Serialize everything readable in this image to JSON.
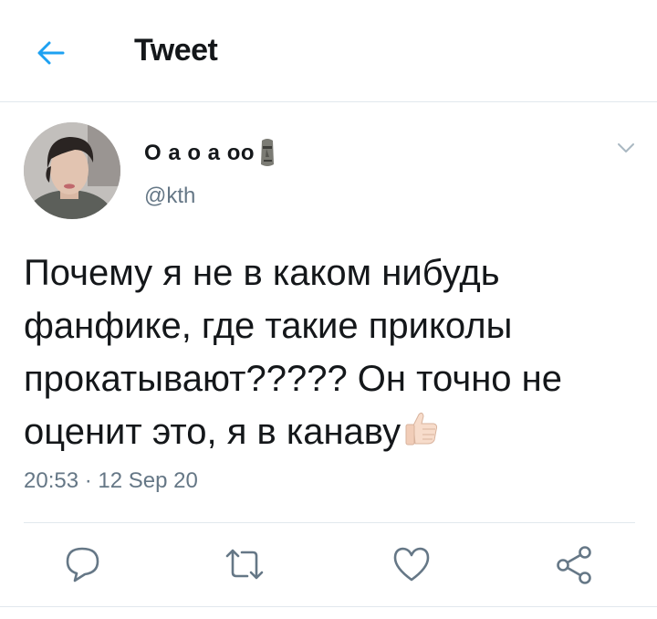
{
  "header": {
    "title": "Tweet"
  },
  "tweet": {
    "author_name": "О а о а оо",
    "handle": "@kth",
    "text": "Почему я не в каком нибудь фанфике, где такие приколы прокатывают????? Он точно не оценит это, я в канаву",
    "time": "20:53",
    "separator": "·",
    "date": "12 Sep 20"
  },
  "icons": {
    "back": "arrow-left-icon",
    "menu": "chevron-down-icon",
    "reply": "reply-icon",
    "retweet": "retweet-icon",
    "like": "heart-icon",
    "share": "share-icon",
    "name_emoji": "moai-emoji",
    "text_emoji": "thumbs-up-emoji"
  },
  "colors": {
    "accent": "#1da1f2",
    "text": "#14171a",
    "secondary": "#657786",
    "divider": "#e1e8ed"
  }
}
